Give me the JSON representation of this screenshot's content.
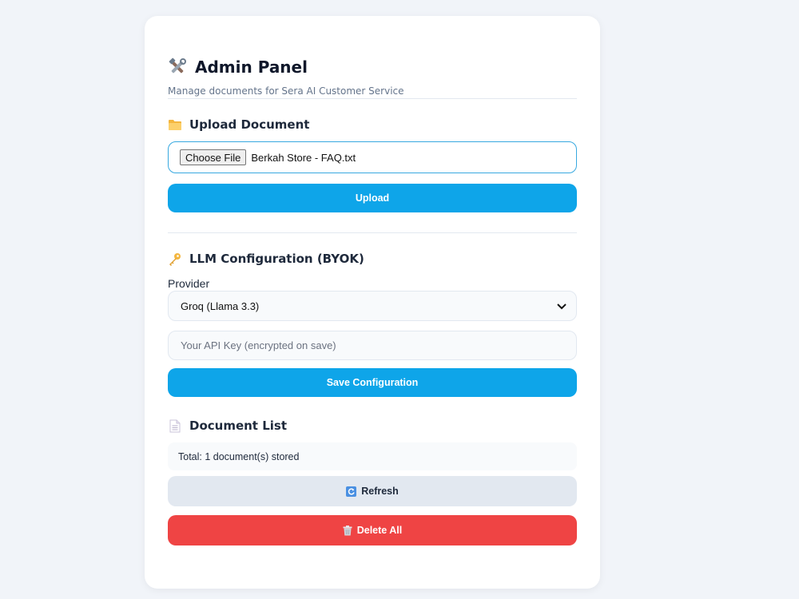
{
  "header": {
    "title": "Admin Panel",
    "subtitle": "Manage documents for Sera AI Customer Service",
    "icon": "tools-icon"
  },
  "upload": {
    "heading": "Upload Document",
    "icon": "folder-icon",
    "choose_label": "Choose File",
    "file_name": "Berkah Store - FAQ.txt",
    "button_label": "Upload"
  },
  "llm": {
    "heading": "LLM Configuration (BYOK)",
    "icon": "key-icon",
    "provider_label": "Provider",
    "provider_value": "Groq (Llama 3.3)",
    "api_key_placeholder": "Your API Key (encrypted on save)",
    "save_label": "Save Configuration"
  },
  "documents": {
    "heading": "Document List",
    "icon": "document-icon",
    "total_text": "Total: 1 document(s) stored",
    "refresh_label": "Refresh",
    "delete_label": "Delete All"
  },
  "colors": {
    "accent": "#0ea5e9",
    "danger": "#ef4444",
    "neutral_button": "#e2e8f0",
    "page_bg": "#f1f4f9"
  }
}
